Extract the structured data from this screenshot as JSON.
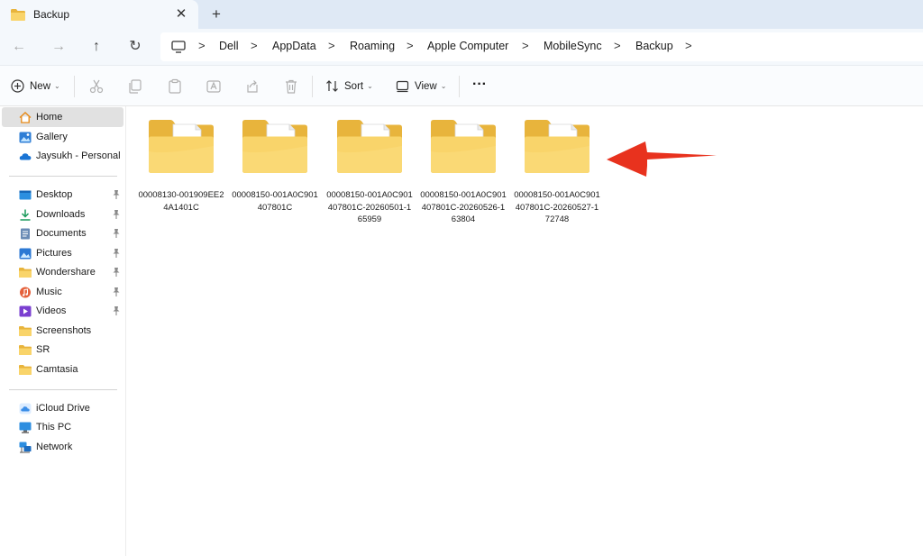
{
  "tab": {
    "title": "Backup",
    "close": "✕",
    "new_tab": "+"
  },
  "nav": {
    "back": "←",
    "forward": "→",
    "up": "↑",
    "refresh": "↻",
    "separator": ">",
    "breadcrumbs": [
      "Dell",
      "AppData",
      "Roaming",
      "Apple Computer",
      "MobileSync",
      "Backup"
    ]
  },
  "commands": {
    "new_label": "New",
    "sort_label": "Sort",
    "view_label": "View",
    "more_label": "···",
    "chevron": "⌄"
  },
  "sidebar": {
    "top": [
      {
        "label": "Home",
        "icon": "home-icon"
      },
      {
        "label": "Gallery",
        "icon": "gallery-icon"
      },
      {
        "label": "Jaysukh - Personal",
        "icon": "onedrive-cloud-icon"
      }
    ],
    "quick": [
      {
        "label": "Desktop",
        "icon": "desktop-icon",
        "pinned": true
      },
      {
        "label": "Downloads",
        "icon": "download-icon",
        "pinned": true
      },
      {
        "label": "Documents",
        "icon": "documents-icon",
        "pinned": true
      },
      {
        "label": "Pictures",
        "icon": "pictures-icon",
        "pinned": true
      },
      {
        "label": "Wondershare",
        "icon": "folder-icon",
        "pinned": true
      },
      {
        "label": "Music",
        "icon": "music-icon",
        "pinned": true
      },
      {
        "label": "Videos",
        "icon": "videos-icon",
        "pinned": true
      },
      {
        "label": "Screenshots",
        "icon": "folder-icon",
        "pinned": false
      },
      {
        "label": "SR",
        "icon": "folder-icon",
        "pinned": false
      },
      {
        "label": "Camtasia",
        "icon": "folder-icon",
        "pinned": false
      }
    ],
    "bottom": [
      {
        "label": "iCloud Drive",
        "icon": "icloud-icon"
      },
      {
        "label": "This PC",
        "icon": "this-pc-icon"
      },
      {
        "label": "Network",
        "icon": "network-icon"
      }
    ]
  },
  "folders": [
    {
      "name": "00008130-001909EE24A1401C"
    },
    {
      "name": "00008150-001A0C901407801C"
    },
    {
      "name": "00008150-001A0C901407801C-20260501-165959"
    },
    {
      "name": "00008150-001A0C901407801C-20260526-163804"
    },
    {
      "name": "00008150-001A0C901407801C-20260527-172748"
    }
  ],
  "colors": {
    "folder_back": "#e8b43c",
    "folder_front": "#f9d46a",
    "arrow": "#e8321e",
    "selection": "#e1e1e1",
    "titlebar": "#dfe9f5"
  }
}
